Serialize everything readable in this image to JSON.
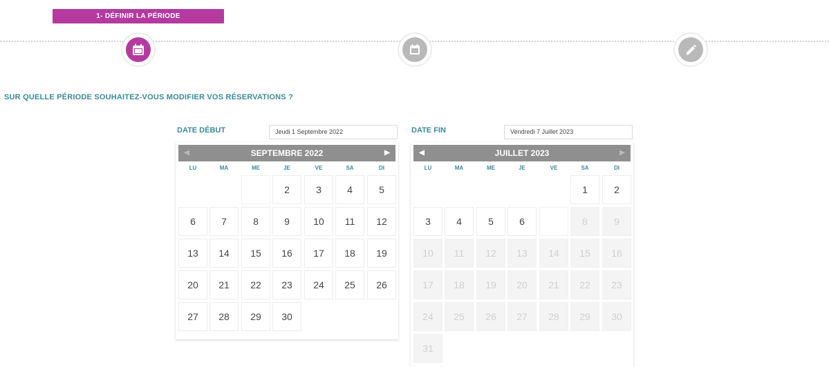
{
  "step_badge": "1- DÉFINIR LA PÉRIODE",
  "steps": [
    {
      "name": "step-period",
      "icon": "calendar-icon",
      "state": "active"
    },
    {
      "name": "step-reservations",
      "icon": "calendar-outline-icon",
      "state": "inactive"
    },
    {
      "name": "step-edit",
      "icon": "pencil-icon",
      "state": "inactive"
    }
  ],
  "question": "SUR QUELLE PÉRIODE SOUHAITEZ-VOUS MODIFIER VOS RÉSERVATIONS ?",
  "colors": {
    "accent": "#b43aa0",
    "label": "#3a8a98",
    "header": "#8f8f8f",
    "inactive_step": "#b9b9b9"
  },
  "start": {
    "label": "DATE DÉBUT",
    "input_value": "Jeudi 1 Septembre 2022",
    "calendar": {
      "month": "SEPTEMBRE 2022",
      "prev": "◀",
      "next": "▶",
      "weekdays": [
        "LU",
        "MA",
        "ME",
        "JE",
        "VE",
        "SA",
        "DI"
      ],
      "leading_blank": 3,
      "days": [
        "2",
        "3",
        "4",
        "5",
        "6",
        "7",
        "8",
        "9",
        "10",
        "11",
        "12",
        "13",
        "14",
        "15",
        "16",
        "17",
        "18",
        "19",
        "20",
        "21",
        "22",
        "23",
        "24",
        "25",
        "26",
        "27",
        "28",
        "29",
        "30"
      ],
      "first_day_offset_blank_boxed": true
    }
  },
  "end": {
    "label": "DATE FIN",
    "input_value": "Vendredi 7 Juillet 2023",
    "calendar": {
      "month": "JUILLET 2023",
      "prev": "◀",
      "next": "▶",
      "weekdays": [
        "LU",
        "MA",
        "ME",
        "JE",
        "VE",
        "SA",
        "DI"
      ],
      "leading_blank": 5,
      "days": [
        "1",
        "2",
        "3",
        "4",
        "5",
        "6",
        "7",
        "8",
        "9",
        "10",
        "11",
        "12",
        "13",
        "14",
        "15",
        "16",
        "17",
        "18",
        "19",
        "20",
        "21",
        "22",
        "23",
        "24",
        "25",
        "26",
        "27",
        "28",
        "29",
        "30",
        "31"
      ],
      "enabled_until": 6,
      "selected_blank": 7
    }
  }
}
